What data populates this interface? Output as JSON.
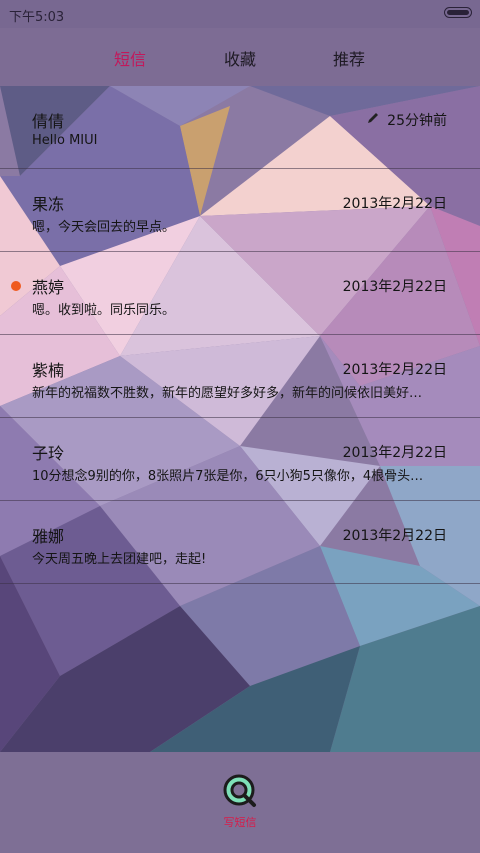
{
  "status_bar": {
    "time": "下午5:03"
  },
  "tabs": [
    {
      "label": "短信",
      "active": true
    },
    {
      "label": "收藏",
      "active": false
    },
    {
      "label": "推荐",
      "active": false
    }
  ],
  "messages": [
    {
      "name": "倩倩",
      "date": "25分钟前",
      "snippet": "Hello MIUI",
      "unread": false,
      "draft": true
    },
    {
      "name": "果冻",
      "date": "2013年2月22日",
      "snippet": "嗯，今天会回去的早点。",
      "unread": false
    },
    {
      "name": "燕婷",
      "date": "2013年2月22日",
      "snippet": "嗯。收到啦。同乐同乐。",
      "unread": true
    },
    {
      "name": "紫楠",
      "date": "2013年2月22日",
      "snippet": "新年的祝福数不胜数，新年的愿望好多好多，新年的问候依旧美好…",
      "unread": false
    },
    {
      "name": "子玲",
      "date": "2013年2月22日",
      "snippet": "10分想念9别的你，8张照片7张是你，6只小狗5只像你，4根骨头…",
      "unread": false
    },
    {
      "name": "雅娜",
      "date": "2013年2月22日",
      "snippet": "今天周五晚上去团建吧，走起!",
      "unread": false
    }
  ],
  "bottom_bar": {
    "compose_label": "写短信"
  },
  "colors": {
    "accent": "#c2185b",
    "unread_dot": "#ef5a1f",
    "compose_icon": "#7ee0b8"
  }
}
